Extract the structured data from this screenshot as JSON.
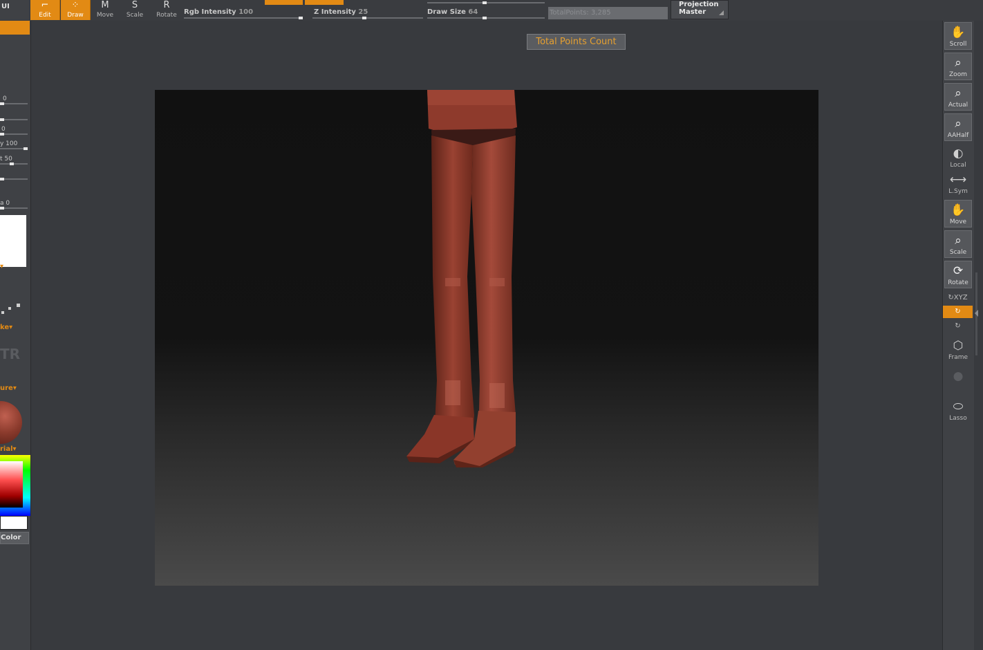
{
  "top_bar": {
    "partial_label": "UI",
    "tools": [
      {
        "name": "edit",
        "label": "Edit",
        "icon": "edit-icon",
        "active": true
      },
      {
        "name": "draw",
        "label": "Draw",
        "icon": "draw-icon",
        "active": true
      },
      {
        "name": "move",
        "label": "Move",
        "icon": "move-icon",
        "active": false
      },
      {
        "name": "scale",
        "label": "Scale",
        "icon": "scale-icon",
        "active": false
      },
      {
        "name": "rotate",
        "label": "Rotate",
        "icon": "rotate-icon",
        "active": false
      }
    ],
    "rgb_intensity": {
      "label": "Rgb Intensity",
      "value": "100"
    },
    "z_intensity": {
      "label": "Z Intensity",
      "value": "25"
    },
    "draw_size": {
      "label": "Draw Size",
      "value": "64"
    },
    "total_points": {
      "label": "TotalPoints:",
      "value": "3,285"
    },
    "projection_master": {
      "line1": "Projection",
      "line2": "Master"
    }
  },
  "left_tray": {
    "slider_values": [
      "0",
      "0",
      "0"
    ],
    "intensity_label": "y 100",
    "focal_label": "t 50",
    "slider_last": "a 0",
    "stroke_label": "ke",
    "texture_label": "ure",
    "material_label": "rial",
    "alpha_letters": "TR",
    "color_label": "Color"
  },
  "canvas": {
    "tooltip": "Total Points Count"
  },
  "right_shelf": {
    "buttons": [
      {
        "label": "Scroll",
        "icon": "scroll-icon"
      },
      {
        "label": "Zoom",
        "icon": "zoom-icon"
      },
      {
        "label": "Actual",
        "icon": "actual-icon"
      },
      {
        "label": "AAHalf",
        "icon": "aahalf-icon"
      },
      {
        "label": "Local",
        "icon": "local-icon"
      },
      {
        "label": "L.Sym",
        "icon": "lsym-icon"
      },
      {
        "label": "Move",
        "icon": "move-icon"
      },
      {
        "label": "Scale",
        "icon": "scale-icon"
      },
      {
        "label": "Rotate",
        "icon": "rotate-icon"
      },
      {
        "label": "XYZ",
        "icon": "xyz-icon"
      },
      {
        "label": "Frame",
        "icon": "frame-icon"
      },
      {
        "label": "Lasso",
        "icon": "lasso-icon"
      }
    ]
  },
  "colors": {
    "accent": "#e28a14",
    "background": "#383a3e",
    "panel": "#3f4145",
    "model": "#8a3a2c"
  }
}
